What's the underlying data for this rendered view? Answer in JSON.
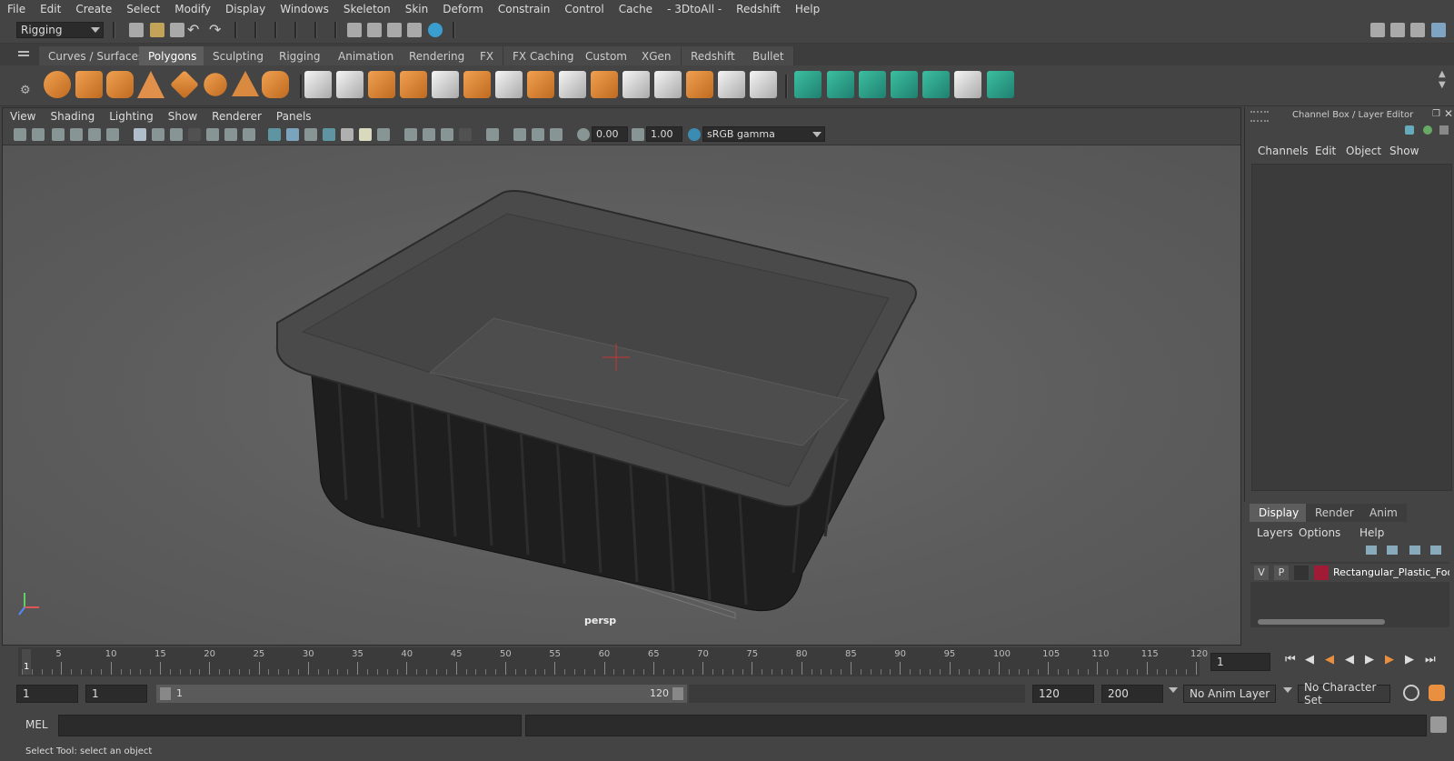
{
  "menubar": {
    "items": [
      "File",
      "Edit",
      "Create",
      "Select",
      "Modify",
      "Display",
      "Windows",
      "Skeleton",
      "Skin",
      "Deform",
      "Constrain",
      "Control",
      "Cache",
      "- 3DtoAll -",
      "Redshift",
      "Help"
    ]
  },
  "statusline": {
    "menuset_value": "Rigging"
  },
  "shelf": {
    "tabs": [
      "Curves / Surfaces",
      "Polygons",
      "Sculpting",
      "Rigging",
      "Animation",
      "Rendering",
      "FX",
      "FX Caching",
      "Custom",
      "XGen",
      "Redshift",
      "Bullet"
    ],
    "active_tab": "Polygons",
    "icons": [
      "poly-sphere-icon",
      "poly-cube-icon",
      "poly-cylinder-icon",
      "poly-cone-icon",
      "poly-plane-icon",
      "poly-torus-icon",
      "poly-pyramid-icon",
      "poly-pipe-icon",
      "combine-icon",
      "separate-icon",
      "extract-icon",
      "smooth-icon",
      "boolean-icon",
      "bevel-icon",
      "bridge-icon",
      "extrude-icon",
      "multi-cut-icon",
      "target-weld-icon",
      "connect-icon",
      "insert-edge-loop-icon",
      "offset-edge-loop-icon",
      "append-polygon-icon",
      "fill-hole-icon",
      "make-hole-icon",
      "uv-editor-icon",
      "planar-map-icon",
      "cylindrical-map-icon",
      "spherical-map-icon",
      "automatic-map-icon",
      "unfold-icon",
      "uv-layout-icon",
      "uv-cut-icon"
    ]
  },
  "viewport": {
    "menu": [
      "View",
      "Shading",
      "Lighting",
      "Show",
      "Renderer",
      "Panels"
    ],
    "exposure": "0.00",
    "gamma": "1.00",
    "color_space": "sRGB gamma",
    "camera_label": "persp"
  },
  "channelbox": {
    "title": "Channel Box / Layer Editor",
    "menu": [
      "Channels",
      "Edit",
      "Object",
      "Show"
    ]
  },
  "layers": {
    "tabs": [
      "Display",
      "Render",
      "Anim"
    ],
    "active_tab": "Display",
    "menu": [
      "Layers",
      "Options",
      "Help"
    ],
    "rows": [
      {
        "v": "V",
        "p": "P",
        "color": "#a01c36",
        "name": "Rectangular_Plastic_Foo"
      }
    ]
  },
  "timeline": {
    "ticks": [
      1,
      5,
      10,
      15,
      20,
      25,
      30,
      35,
      40,
      45,
      50,
      55,
      60,
      65,
      70,
      75,
      80,
      85,
      90,
      95,
      100,
      105,
      110,
      115,
      120
    ],
    "current_frame": "1",
    "current_frame_field": "1"
  },
  "range": {
    "start": "1",
    "playback_start": "1",
    "slider_start": "1",
    "slider_end": "120",
    "playback_end": "120",
    "end": "200",
    "anim_layer": "No Anim Layer",
    "character_set": "No Character Set"
  },
  "commandline": {
    "label": "MEL"
  },
  "helpline": {
    "text": "Select Tool: select an object"
  }
}
